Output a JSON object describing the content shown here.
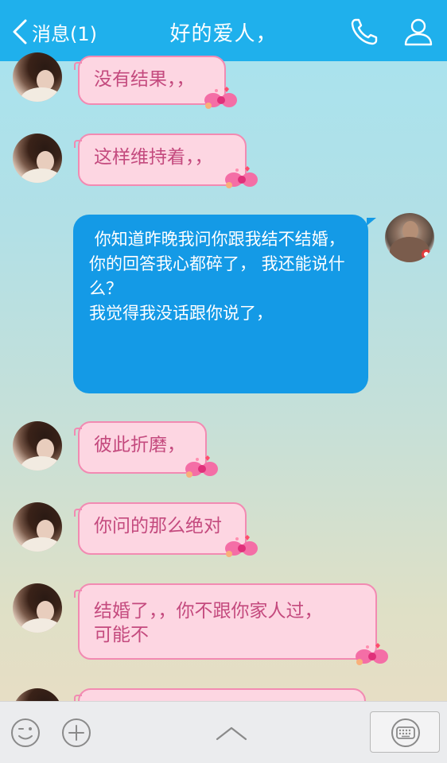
{
  "header": {
    "back_label": "消息(1)",
    "title": "好的爱人，"
  },
  "messages": [
    {
      "from": "contact",
      "text": "没有结果，，"
    },
    {
      "from": "contact",
      "text": "这样维持着，，"
    },
    {
      "from": "me",
      "text": " 你知道昨晚我问你跟我结不结婚，\n你的回答我心都碎了， 我还能说什么？\n我觉得我没话跟你说了，"
    },
    {
      "from": "contact",
      "text": "彼此折磨，"
    },
    {
      "from": "contact",
      "text": "你问的那么绝对"
    },
    {
      "from": "contact",
      "text": "结婚了，，你不跟你家人过，可能不"
    }
  ],
  "icons": {
    "back": "chevron-left-icon",
    "call": "phone-icon",
    "profile": "person-icon",
    "emoji": "smiley-icon",
    "plus": "plus-icon",
    "expand": "chevron-up-icon",
    "keyboard": "keyboard-icon"
  },
  "colors": {
    "header": "#1fb0ec",
    "bubble_in_bg": "#fdd6e2",
    "bubble_in_border": "#f28ab2",
    "bubble_in_text": "#c44a7e",
    "bubble_out_bg": "#149ae6"
  }
}
